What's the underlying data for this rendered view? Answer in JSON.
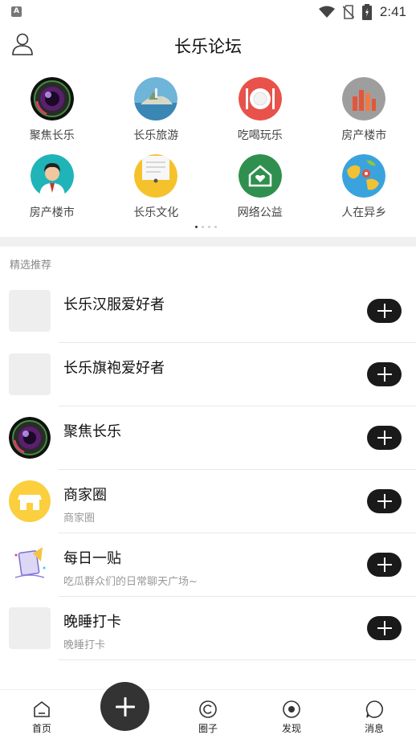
{
  "status_bar": {
    "time": "2:41",
    "left_badge": "A",
    "icons": [
      "wifi-icon",
      "no-sim-icon",
      "battery-icon"
    ]
  },
  "header": {
    "title": "长乐论坛",
    "left_icon": "user-icon"
  },
  "categories": [
    {
      "label": "聚焦长乐",
      "icon": "camera-lens-icon"
    },
    {
      "label": "长乐旅游",
      "icon": "island-icon"
    },
    {
      "label": "吃喝玩乐",
      "icon": "dining-icon"
    },
    {
      "label": "房产楼市",
      "icon": "buildings-icon"
    },
    {
      "label": "房产楼市",
      "icon": "agent-icon"
    },
    {
      "label": "长乐文化",
      "icon": "document-icon"
    },
    {
      "label": "网络公益",
      "icon": "charity-home-icon"
    },
    {
      "label": "人在异乡",
      "icon": "globe-pin-icon"
    }
  ],
  "section": {
    "title": "精选推荐"
  },
  "circles": [
    {
      "name": "长乐汉服爱好者",
      "sub": "",
      "thumb": "placeholder"
    },
    {
      "name": "长乐旗袍爱好者",
      "sub": "",
      "thumb": "placeholder"
    },
    {
      "name": "聚焦长乐",
      "sub": "",
      "thumb": "camera-lens"
    },
    {
      "name": "商家圈",
      "sub": "商家圈",
      "thumb": "shop"
    },
    {
      "name": "每日一贴",
      "sub": "吃瓜群众们的日常聊天广场~",
      "thumb": "note"
    },
    {
      "name": "晚睡打卡",
      "sub": "晚睡打卡",
      "thumb": "placeholder"
    }
  ],
  "bottom_nav": [
    {
      "label": "首页",
      "icon": "home-icon"
    },
    {
      "label": "圈子",
      "icon": "circle-icon"
    },
    {
      "label": "发现",
      "icon": "discover-icon"
    },
    {
      "label": "消息",
      "icon": "message-icon"
    }
  ],
  "colors": {
    "accent": "#1a1a1a",
    "band": "#f0f0f0",
    "subtext": "#999999"
  }
}
